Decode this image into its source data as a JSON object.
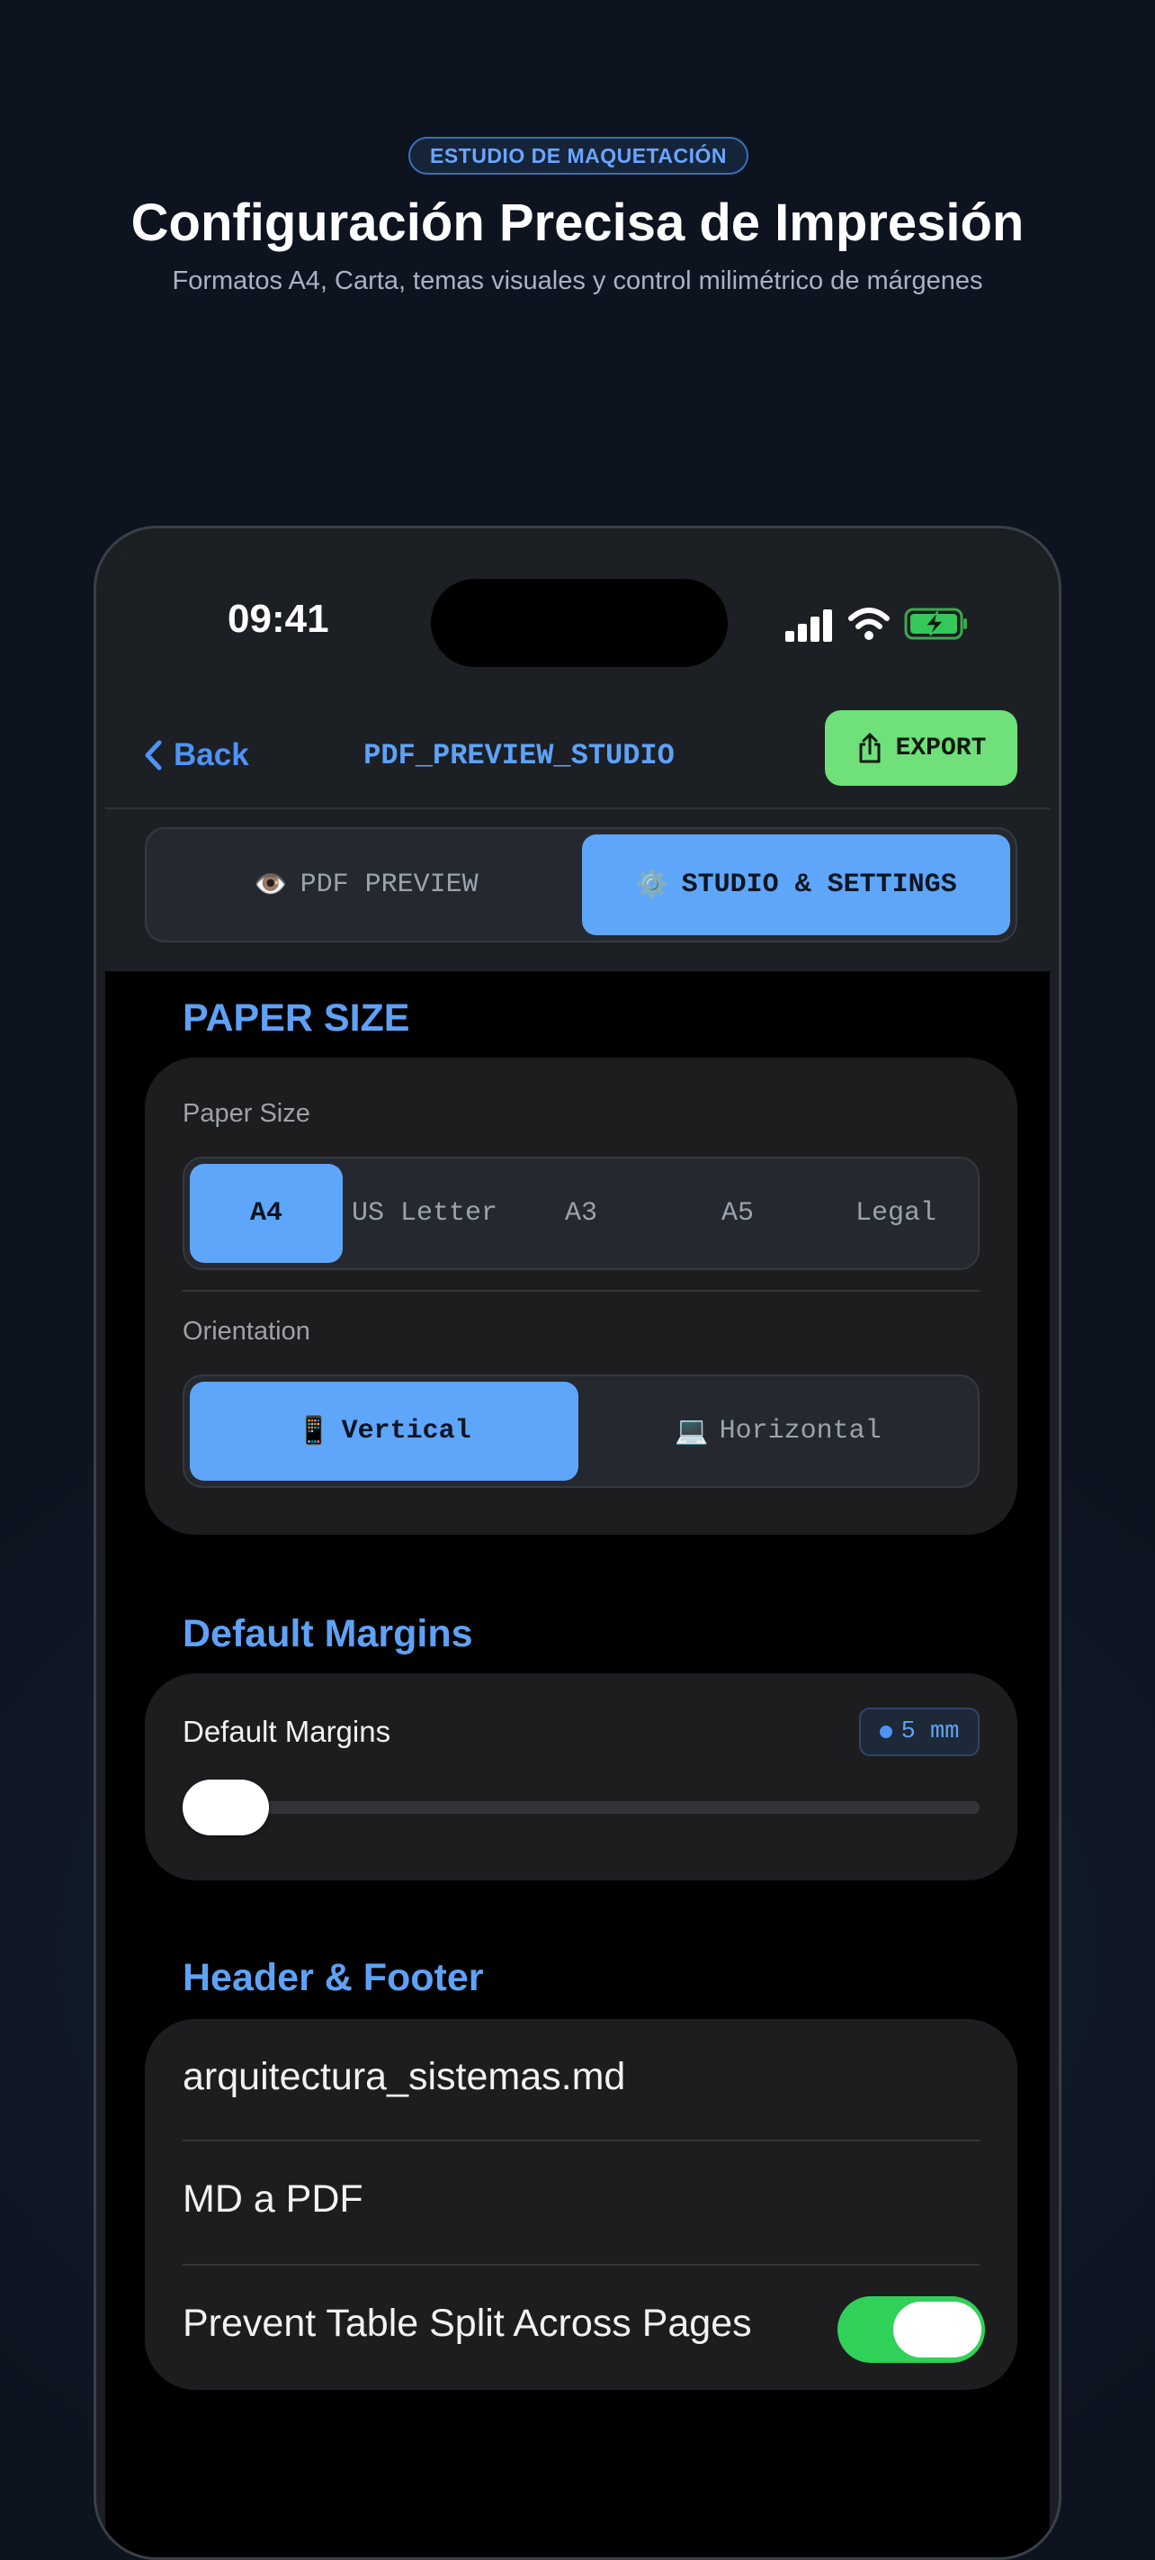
{
  "hero": {
    "badge": "ESTUDIO DE MAQUETACIÓN",
    "title": "Configuración Precisa de Impresión",
    "subtitle": "Formatos A4, Carta, temas visuales y control milimétrico de márgenes"
  },
  "status_bar": {
    "time": "09:41",
    "icons": [
      "cellular-signal-icon",
      "wifi-icon",
      "battery-charging-icon"
    ]
  },
  "nav": {
    "back_label": "Back",
    "title": "PDF_PREVIEW_STUDIO",
    "export_label": "EXPORT"
  },
  "view_switch": {
    "options": [
      {
        "icon": "👁️",
        "label": "PDF PREVIEW",
        "selected": false
      },
      {
        "icon": "⚙️",
        "label": "STUDIO & SETTINGS",
        "selected": true
      }
    ]
  },
  "paper": {
    "section_title": "PAPER SIZE",
    "size_label": "Paper Size",
    "sizes": [
      {
        "label": "A4",
        "selected": true
      },
      {
        "label": "US Letter",
        "selected": false
      },
      {
        "label": "A3",
        "selected": false
      },
      {
        "label": "A5",
        "selected": false
      },
      {
        "label": "Legal",
        "selected": false
      }
    ],
    "orientation_label": "Orientation",
    "orientations": [
      {
        "icon": "📱",
        "label": "Vertical",
        "selected": true
      },
      {
        "icon": "💻",
        "label": "Horizontal",
        "selected": false
      }
    ]
  },
  "margins": {
    "section_title": "Default Margins",
    "label": "Default Margins",
    "value_text": "5 mm",
    "slider_fraction": 0.0
  },
  "header_footer": {
    "section_title": "Header & Footer",
    "header_text": "arquitectura_sistemas.md",
    "footer_text": "MD a PDF",
    "toggle_label": "Prevent Table Split Across Pages",
    "toggle_on": true
  },
  "colors": {
    "accent": "#5ea6fa",
    "export": "#6fe07a",
    "toggle_on": "#30d158"
  }
}
